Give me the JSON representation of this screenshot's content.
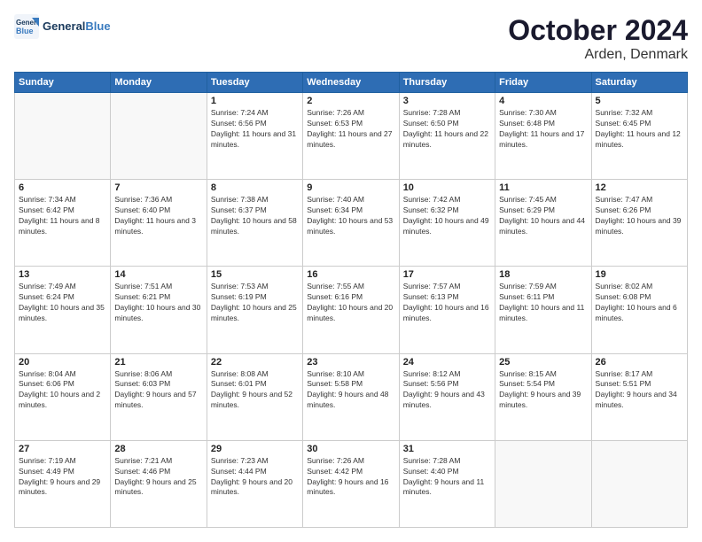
{
  "header": {
    "logo_general": "General",
    "logo_blue": "Blue",
    "month_title": "October 2024",
    "location": "Arden, Denmark"
  },
  "weekdays": [
    "Sunday",
    "Monday",
    "Tuesday",
    "Wednesday",
    "Thursday",
    "Friday",
    "Saturday"
  ],
  "weeks": [
    [
      {
        "day": "",
        "sunrise": "",
        "sunset": "",
        "daylight": ""
      },
      {
        "day": "",
        "sunrise": "",
        "sunset": "",
        "daylight": ""
      },
      {
        "day": "1",
        "sunrise": "Sunrise: 7:24 AM",
        "sunset": "Sunset: 6:56 PM",
        "daylight": "Daylight: 11 hours and 31 minutes."
      },
      {
        "day": "2",
        "sunrise": "Sunrise: 7:26 AM",
        "sunset": "Sunset: 6:53 PM",
        "daylight": "Daylight: 11 hours and 27 minutes."
      },
      {
        "day": "3",
        "sunrise": "Sunrise: 7:28 AM",
        "sunset": "Sunset: 6:50 PM",
        "daylight": "Daylight: 11 hours and 22 minutes."
      },
      {
        "day": "4",
        "sunrise": "Sunrise: 7:30 AM",
        "sunset": "Sunset: 6:48 PM",
        "daylight": "Daylight: 11 hours and 17 minutes."
      },
      {
        "day": "5",
        "sunrise": "Sunrise: 7:32 AM",
        "sunset": "Sunset: 6:45 PM",
        "daylight": "Daylight: 11 hours and 12 minutes."
      }
    ],
    [
      {
        "day": "6",
        "sunrise": "Sunrise: 7:34 AM",
        "sunset": "Sunset: 6:42 PM",
        "daylight": "Daylight: 11 hours and 8 minutes."
      },
      {
        "day": "7",
        "sunrise": "Sunrise: 7:36 AM",
        "sunset": "Sunset: 6:40 PM",
        "daylight": "Daylight: 11 hours and 3 minutes."
      },
      {
        "day": "8",
        "sunrise": "Sunrise: 7:38 AM",
        "sunset": "Sunset: 6:37 PM",
        "daylight": "Daylight: 10 hours and 58 minutes."
      },
      {
        "day": "9",
        "sunrise": "Sunrise: 7:40 AM",
        "sunset": "Sunset: 6:34 PM",
        "daylight": "Daylight: 10 hours and 53 minutes."
      },
      {
        "day": "10",
        "sunrise": "Sunrise: 7:42 AM",
        "sunset": "Sunset: 6:32 PM",
        "daylight": "Daylight: 10 hours and 49 minutes."
      },
      {
        "day": "11",
        "sunrise": "Sunrise: 7:45 AM",
        "sunset": "Sunset: 6:29 PM",
        "daylight": "Daylight: 10 hours and 44 minutes."
      },
      {
        "day": "12",
        "sunrise": "Sunrise: 7:47 AM",
        "sunset": "Sunset: 6:26 PM",
        "daylight": "Daylight: 10 hours and 39 minutes."
      }
    ],
    [
      {
        "day": "13",
        "sunrise": "Sunrise: 7:49 AM",
        "sunset": "Sunset: 6:24 PM",
        "daylight": "Daylight: 10 hours and 35 minutes."
      },
      {
        "day": "14",
        "sunrise": "Sunrise: 7:51 AM",
        "sunset": "Sunset: 6:21 PM",
        "daylight": "Daylight: 10 hours and 30 minutes."
      },
      {
        "day": "15",
        "sunrise": "Sunrise: 7:53 AM",
        "sunset": "Sunset: 6:19 PM",
        "daylight": "Daylight: 10 hours and 25 minutes."
      },
      {
        "day": "16",
        "sunrise": "Sunrise: 7:55 AM",
        "sunset": "Sunset: 6:16 PM",
        "daylight": "Daylight: 10 hours and 20 minutes."
      },
      {
        "day": "17",
        "sunrise": "Sunrise: 7:57 AM",
        "sunset": "Sunset: 6:13 PM",
        "daylight": "Daylight: 10 hours and 16 minutes."
      },
      {
        "day": "18",
        "sunrise": "Sunrise: 7:59 AM",
        "sunset": "Sunset: 6:11 PM",
        "daylight": "Daylight: 10 hours and 11 minutes."
      },
      {
        "day": "19",
        "sunrise": "Sunrise: 8:02 AM",
        "sunset": "Sunset: 6:08 PM",
        "daylight": "Daylight: 10 hours and 6 minutes."
      }
    ],
    [
      {
        "day": "20",
        "sunrise": "Sunrise: 8:04 AM",
        "sunset": "Sunset: 6:06 PM",
        "daylight": "Daylight: 10 hours and 2 minutes."
      },
      {
        "day": "21",
        "sunrise": "Sunrise: 8:06 AM",
        "sunset": "Sunset: 6:03 PM",
        "daylight": "Daylight: 9 hours and 57 minutes."
      },
      {
        "day": "22",
        "sunrise": "Sunrise: 8:08 AM",
        "sunset": "Sunset: 6:01 PM",
        "daylight": "Daylight: 9 hours and 52 minutes."
      },
      {
        "day": "23",
        "sunrise": "Sunrise: 8:10 AM",
        "sunset": "Sunset: 5:58 PM",
        "daylight": "Daylight: 9 hours and 48 minutes."
      },
      {
        "day": "24",
        "sunrise": "Sunrise: 8:12 AM",
        "sunset": "Sunset: 5:56 PM",
        "daylight": "Daylight: 9 hours and 43 minutes."
      },
      {
        "day": "25",
        "sunrise": "Sunrise: 8:15 AM",
        "sunset": "Sunset: 5:54 PM",
        "daylight": "Daylight: 9 hours and 39 minutes."
      },
      {
        "day": "26",
        "sunrise": "Sunrise: 8:17 AM",
        "sunset": "Sunset: 5:51 PM",
        "daylight": "Daylight: 9 hours and 34 minutes."
      }
    ],
    [
      {
        "day": "27",
        "sunrise": "Sunrise: 7:19 AM",
        "sunset": "Sunset: 4:49 PM",
        "daylight": "Daylight: 9 hours and 29 minutes."
      },
      {
        "day": "28",
        "sunrise": "Sunrise: 7:21 AM",
        "sunset": "Sunset: 4:46 PM",
        "daylight": "Daylight: 9 hours and 25 minutes."
      },
      {
        "day": "29",
        "sunrise": "Sunrise: 7:23 AM",
        "sunset": "Sunset: 4:44 PM",
        "daylight": "Daylight: 9 hours and 20 minutes."
      },
      {
        "day": "30",
        "sunrise": "Sunrise: 7:26 AM",
        "sunset": "Sunset: 4:42 PM",
        "daylight": "Daylight: 9 hours and 16 minutes."
      },
      {
        "day": "31",
        "sunrise": "Sunrise: 7:28 AM",
        "sunset": "Sunset: 4:40 PM",
        "daylight": "Daylight: 9 hours and 11 minutes."
      },
      {
        "day": "",
        "sunrise": "",
        "sunset": "",
        "daylight": ""
      },
      {
        "day": "",
        "sunrise": "",
        "sunset": "",
        "daylight": ""
      }
    ]
  ]
}
